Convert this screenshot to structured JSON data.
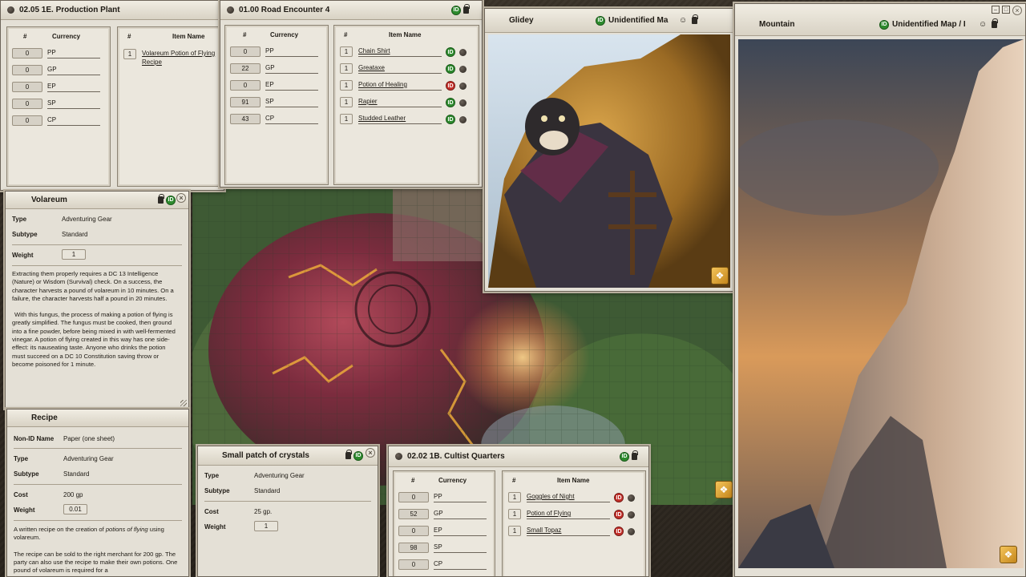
{
  "windows": {
    "production_plant": {
      "title": "02.05 1E. Production Plant",
      "currency_header": {
        "num": "#",
        "label": "Currency"
      },
      "items_header": {
        "num": "#",
        "label": "Item Name"
      },
      "currency": [
        {
          "amount": "0",
          "code": "PP"
        },
        {
          "amount": "0",
          "code": "GP"
        },
        {
          "amount": "0",
          "code": "EP"
        },
        {
          "amount": "0",
          "code": "SP"
        },
        {
          "amount": "0",
          "code": "CP"
        }
      ],
      "items": [
        {
          "qty": "1",
          "name": "Volareum Potion of Flying Recipe"
        }
      ]
    },
    "road_encounter": {
      "title": "01.00 Road Encounter 4",
      "currency_header": {
        "num": "#",
        "label": "Currency"
      },
      "items_header": {
        "num": "#",
        "label": "Item Name"
      },
      "currency": [
        {
          "amount": "0",
          "code": "PP"
        },
        {
          "amount": "22",
          "code": "GP"
        },
        {
          "amount": "0",
          "code": "EP"
        },
        {
          "amount": "91",
          "code": "SP"
        },
        {
          "amount": "43",
          "code": "CP"
        }
      ],
      "items": [
        {
          "qty": "1",
          "name": "Chain Shirt",
          "id_state": "identified"
        },
        {
          "qty": "1",
          "name": "Greataxe",
          "id_state": "identified"
        },
        {
          "qty": "1",
          "name": "Potion of Healing",
          "id_state": "unidentified"
        },
        {
          "qty": "1",
          "name": "Rapier",
          "id_state": "identified"
        },
        {
          "qty": "1",
          "name": "Studded Leather",
          "id_state": "identified"
        }
      ]
    },
    "glidey": {
      "title": "Glidey",
      "id_label": "Unidentified Ma",
      "id_badge": "ID"
    },
    "mountain": {
      "title": "Mountain",
      "id_label": "Unidentified Map / I",
      "id_badge": "ID"
    },
    "volareum": {
      "title": "Volareum",
      "type_label": "Type",
      "type_value": "Adventuring Gear",
      "subtype_label": "Subtype",
      "subtype_value": "Standard",
      "weight_label": "Weight",
      "weight_value": "1",
      "desc1": "Extracting them properly requires a DC 13 Intelligence (Nature) or Wisdom (Survival) check. On a success, the character harvests a pound of volareum in 10 minutes. On a failure, the character harvests half a pound in 20 minutes.",
      "desc2": "With this fungus, the process of making a potion of flying is greatly simplified. The fungus must be cooked, then ground into a fine powder, before being mixed in with well-fermented vinegar. A potion of flying created in this way has one side-effect: its nauseating taste. Anyone who drinks the potion must succeed on a DC 10 Constitution saving throw or become poisoned for 1 minute."
    },
    "recipe": {
      "title": "Recipe",
      "nonid_label": "Non-ID Name",
      "nonid_value": "Paper (one sheet)",
      "type_label": "Type",
      "type_value": "Adventuring Gear",
      "subtype_label": "Subtype",
      "subtype_value": "Standard",
      "cost_label": "Cost",
      "cost_value": "200 gp",
      "weight_label": "Weight",
      "weight_value": "0.01",
      "desc_pre": "A written recipe on the creation of ",
      "desc_em": "potions of flying",
      "desc_post": " using volareum.",
      "desc2": "The recipe can be sold to the right merchant for 200 gp. The party can also use the recipe to make their own potions. One pound of volareum is required for a"
    },
    "crystals": {
      "title": "Small patch of crystals",
      "type_label": "Type",
      "type_value": "Adventuring Gear",
      "subtype_label": "Subtype",
      "subtype_value": "Standard",
      "cost_label": "Cost",
      "cost_value": "25 gp.",
      "weight_label": "Weight",
      "weight_value": "1"
    },
    "cultist_quarters": {
      "title": "02.02 1B. Cultist Quarters",
      "currency_header": {
        "num": "#",
        "label": "Currency"
      },
      "items_header": {
        "num": "#",
        "label": "Item Name"
      },
      "currency": [
        {
          "amount": "0",
          "code": "PP"
        },
        {
          "amount": "52",
          "code": "GP"
        },
        {
          "amount": "0",
          "code": "EP"
        },
        {
          "amount": "98",
          "code": "SP"
        },
        {
          "amount": "0",
          "code": "CP"
        }
      ],
      "items": [
        {
          "qty": "1",
          "name": "Goggles of Night",
          "id_state": "unidentified"
        },
        {
          "qty": "1",
          "name": "Potion of Flying",
          "id_state": "unidentified"
        },
        {
          "qty": "1",
          "name": "Small Topaz",
          "id_state": "unidentified"
        }
      ]
    }
  },
  "icons": {
    "id": "ID",
    "close": "×",
    "map_badge": "❖",
    "window_min": "–",
    "window_max": "□"
  },
  "colors": {
    "panel_bg": "#e4e0d6",
    "id_identified": "#2e8b2e",
    "id_unidentified": "#c4312b"
  }
}
